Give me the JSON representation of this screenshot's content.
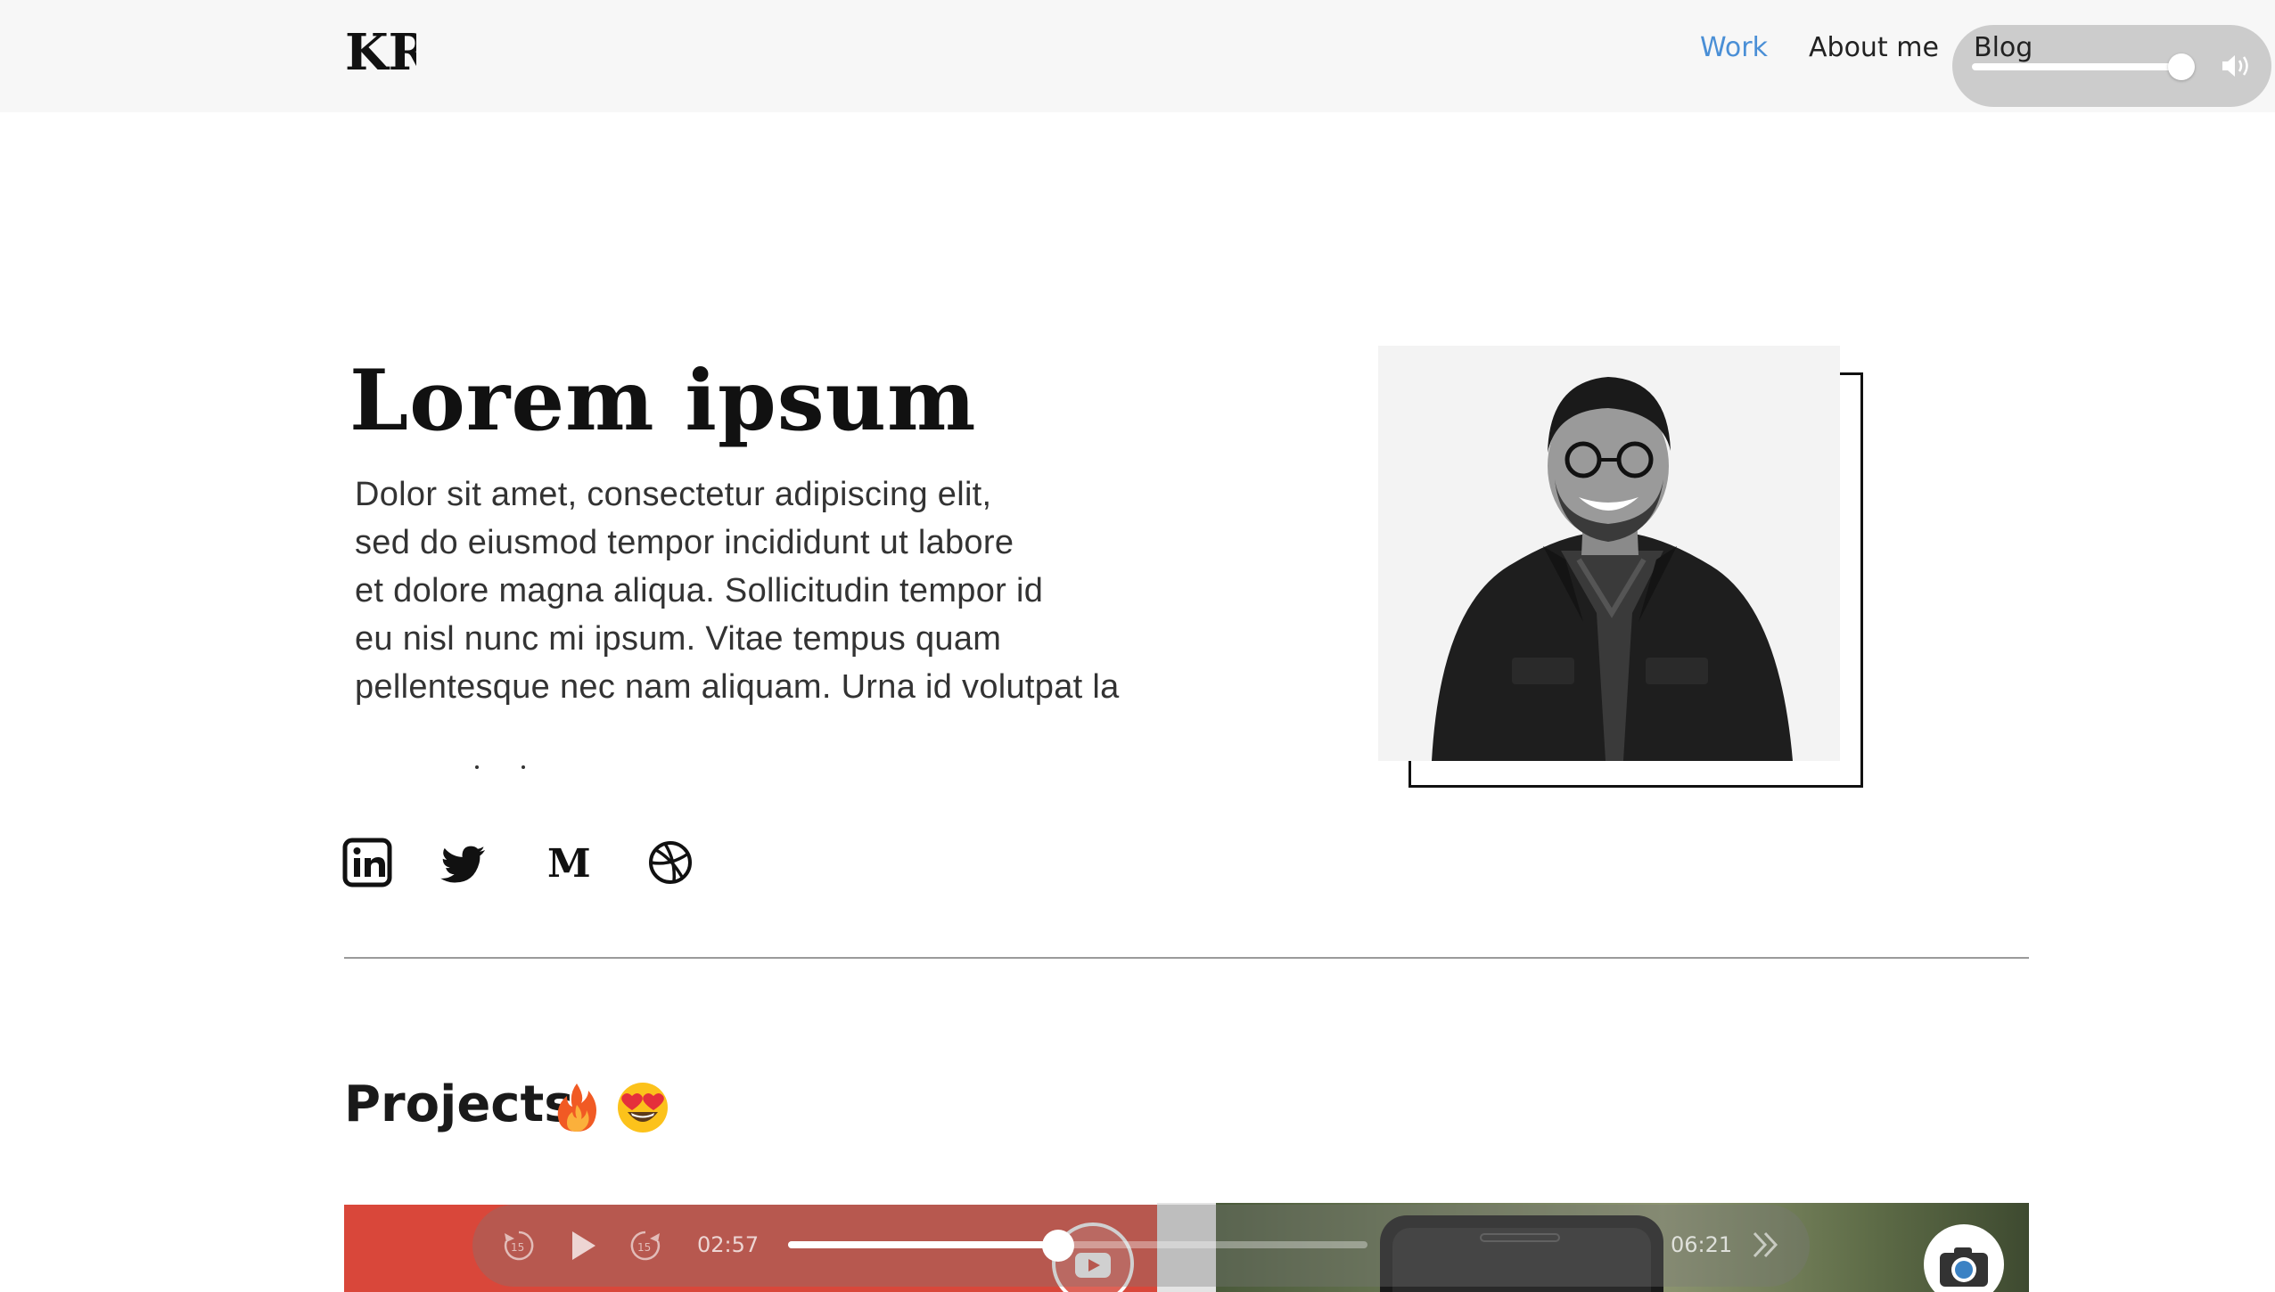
{
  "nav": {
    "logo_text": "KR",
    "links": [
      {
        "label": "Work",
        "active": true
      },
      {
        "label": "About me",
        "active": false
      },
      {
        "label": "Blog",
        "active": false
      }
    ]
  },
  "volume": {
    "level": 0.94,
    "icon": "speaker-wave-icon"
  },
  "hero": {
    "title": "Lorem ipsum",
    "lines": [
      "Dolor sit amet, consectetur adipiscing elit,",
      "sed do eiusmod tempor incididunt ut labore",
      "et dolore magna aliqua. Sollicitudin tempor id",
      "eu nisl nunc mi ipsum. Vitae tempus quam",
      "pellentesque nec nam aliquam. Urna id volutpat la"
    ]
  },
  "social": [
    {
      "name": "linkedin-icon"
    },
    {
      "name": "twitter-icon"
    },
    {
      "name": "medium-icon"
    },
    {
      "name": "dribbble-icon"
    }
  ],
  "projects": {
    "title": "Projects",
    "emojis": [
      "fire-emoji-icon",
      "heart-eyes-emoji-icon"
    ]
  },
  "player": {
    "current_time": "02:57",
    "total_time": "06:21",
    "progress": 0.466
  },
  "colors": {
    "accent": "#4a8fd6",
    "project_red": "#d9473a"
  }
}
